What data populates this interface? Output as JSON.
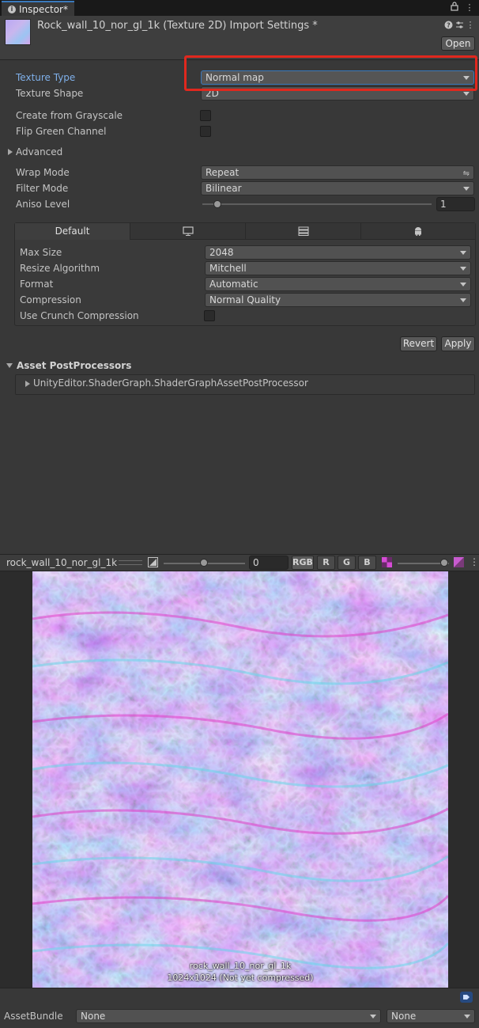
{
  "tab": {
    "title": "Inspector*"
  },
  "header": {
    "title": "Rock_wall_10_nor_gl_1k (Texture 2D) Import Settings *",
    "open_label": "Open"
  },
  "settings": {
    "texture_type": {
      "label": "Texture Type",
      "value": "Normal map"
    },
    "texture_shape": {
      "label": "Texture Shape",
      "value": "2D"
    },
    "create_from_grayscale": {
      "label": "Create from Grayscale",
      "checked": false
    },
    "flip_green_channel": {
      "label": "Flip Green Channel",
      "checked": false
    },
    "advanced": {
      "label": "Advanced"
    },
    "wrap_mode": {
      "label": "Wrap Mode",
      "value": "Repeat"
    },
    "filter_mode": {
      "label": "Filter Mode",
      "value": "Bilinear"
    },
    "aniso_level": {
      "label": "Aniso Level",
      "value": "1"
    }
  },
  "platforms": {
    "tabs": [
      {
        "label": "Default",
        "icon": ""
      },
      {
        "label": "",
        "icon": "monitor-icon"
      },
      {
        "label": "",
        "icon": "server-icon"
      },
      {
        "label": "",
        "icon": "android-icon"
      }
    ],
    "max_size": {
      "label": "Max Size",
      "value": "2048"
    },
    "resize_algorithm": {
      "label": "Resize Algorithm",
      "value": "Mitchell"
    },
    "format": {
      "label": "Format",
      "value": "Automatic"
    },
    "compression": {
      "label": "Compression",
      "value": "Normal Quality"
    },
    "use_crunch": {
      "label": "Use Crunch Compression",
      "checked": false
    }
  },
  "actions": {
    "revert": "Revert",
    "apply": "Apply"
  },
  "postprocessors": {
    "title": "Asset PostProcessors",
    "item": "UnityEditor.ShaderGraph.ShaderGraphAssetPostProcessor"
  },
  "preview": {
    "name": "rock_wall_10_nor_gl_1k",
    "mip_value": "0",
    "channels": [
      "RGB",
      "R",
      "G",
      "B"
    ],
    "caption_name": "rock_wall_10_nor_gl_1k",
    "caption_info": "1024x1024 (Not yet compressed)"
  },
  "asset_bundle": {
    "label": "AssetBundle",
    "name": "None",
    "variant": "None"
  },
  "colors": {
    "accent": "#3a79bb",
    "highlight": "#e0281e",
    "active_label": "#7fb0ea"
  }
}
